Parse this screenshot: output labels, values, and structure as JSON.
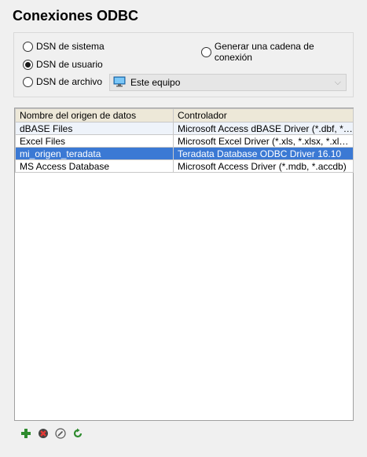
{
  "title": "Conexiones ODBC",
  "options": {
    "dsn_sistema": "DSN de sistema",
    "dsn_usuario": "DSN de usuario",
    "dsn_archivo": "DSN de archivo",
    "cadena_conexion": "Generar una cadena de conexión",
    "selected": "dsn_usuario"
  },
  "location_combo": {
    "value": "Este equipo",
    "icon": "computer-icon"
  },
  "table": {
    "headers": [
      "Nombre del origen de datos",
      "Controlador"
    ],
    "rows": [
      {
        "name": "dBASE Files",
        "driver": "Microsoft Access dBASE Driver (*.dbf, *.n..."
      },
      {
        "name": "Excel Files",
        "driver": "Microsoft Excel Driver (*.xls, *.xlsx, *.xlsm,..."
      },
      {
        "name": "mi_origen_teradata",
        "driver": "Teradata Database ODBC Driver 16.10"
      },
      {
        "name": "MS Access Database",
        "driver": "Microsoft Access Driver (*.mdb, *.accdb)"
      }
    ],
    "selected_row": 2
  },
  "toolbar": {
    "add_icon": "add-icon",
    "delete_icon": "delete-icon",
    "edit_icon": "edit-icon",
    "refresh_icon": "refresh-icon"
  },
  "colors": {
    "selection": "#3b79d4",
    "header_bg": "#ede8d8",
    "add_green": "#2e8b2e",
    "delete_red": "#c0392b"
  }
}
